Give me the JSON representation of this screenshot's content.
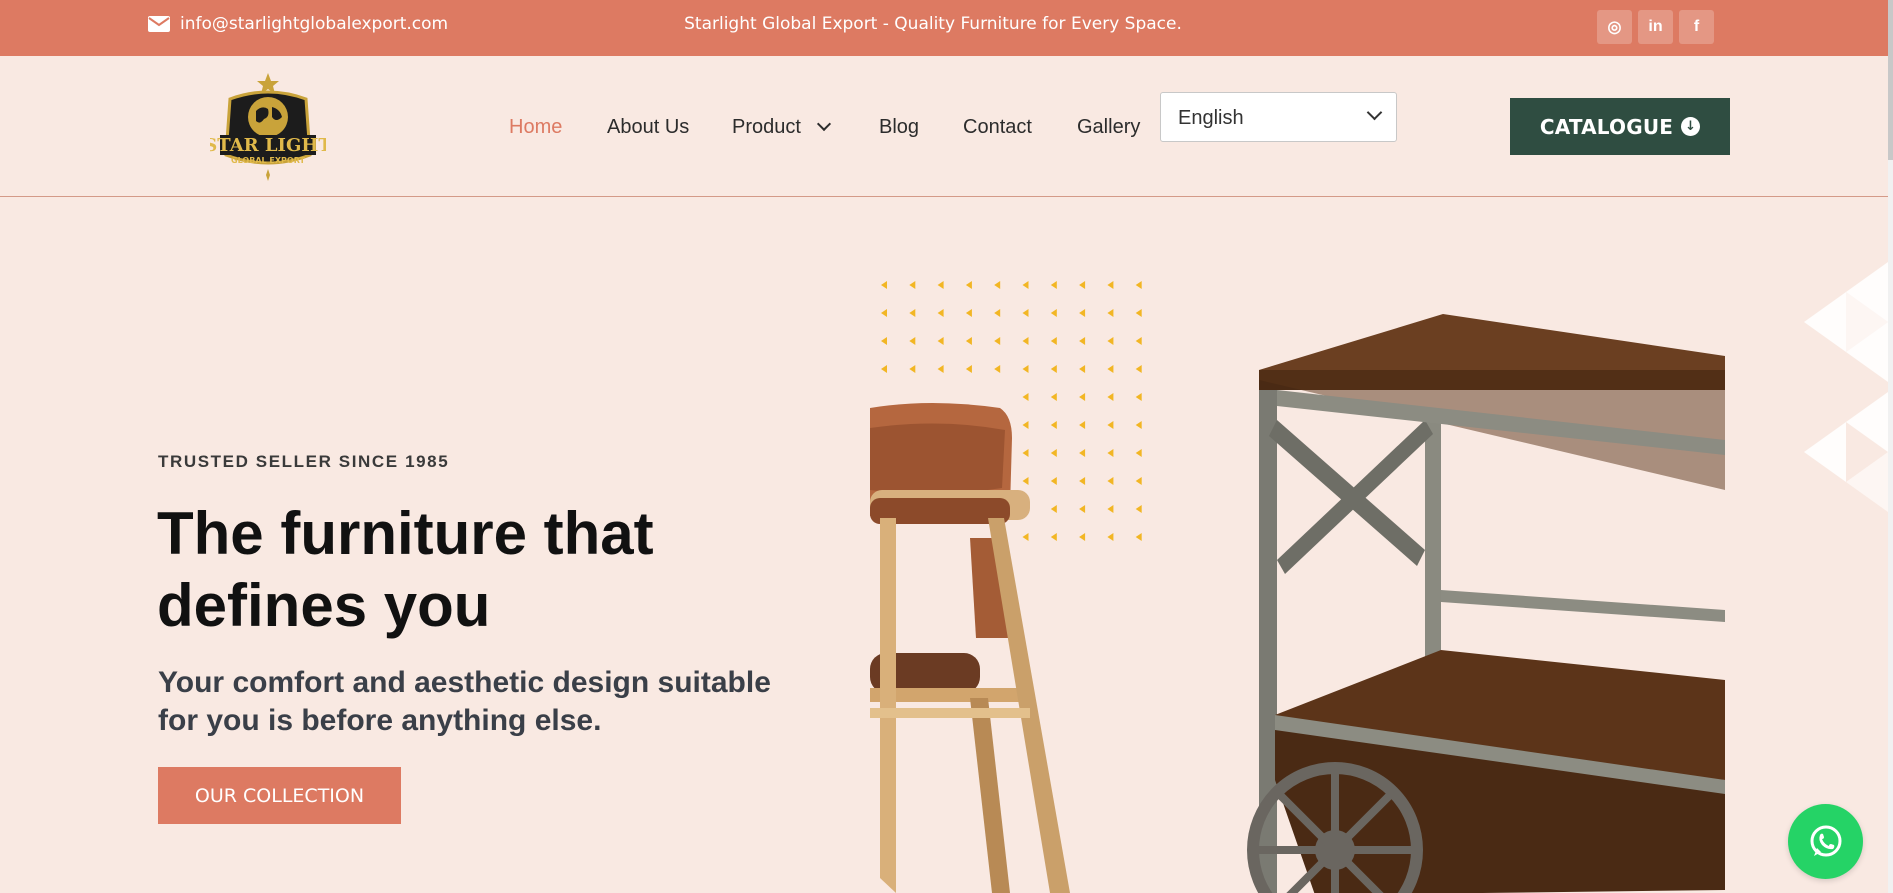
{
  "topbar": {
    "email": "info@starlightglobalexport.com",
    "tagline": "Starlight Global Export - Quality Furniture for Every Space.",
    "social": [
      {
        "name": "instagram-icon",
        "glyph": "◎"
      },
      {
        "name": "linkedin-icon",
        "glyph": "in"
      },
      {
        "name": "facebook-icon",
        "glyph": "f"
      }
    ],
    "background": "#dd7a62"
  },
  "logo": {
    "line1": "STAR LIGHT",
    "line2": "GLOBAL EXPORT"
  },
  "nav": {
    "items": [
      {
        "label": "Home",
        "active": true
      },
      {
        "label": "About Us",
        "active": false
      },
      {
        "label": "Product",
        "active": false,
        "has_dropdown": true
      },
      {
        "label": "Blog",
        "active": false
      },
      {
        "label": "Contact",
        "active": false
      },
      {
        "label": "Gallery",
        "active": false
      }
    ],
    "active_color": "#dd7a62"
  },
  "language": {
    "selected": "English"
  },
  "catalogue": {
    "label": "CATALOGUE",
    "icon": "download-icon",
    "color": "#2f4d41"
  },
  "hero": {
    "eyebrow": "TRUSTED SELLER SINCE 1985",
    "headline": "The furniture that defines you",
    "subheading": "Your comfort and aesthetic design suitable for you is before anything else.",
    "cta_label": "OUR COLLECTION",
    "background": "#f9e9e2"
  },
  "whatsapp": {
    "icon": "whatsapp-icon",
    "color": "#25d366"
  }
}
